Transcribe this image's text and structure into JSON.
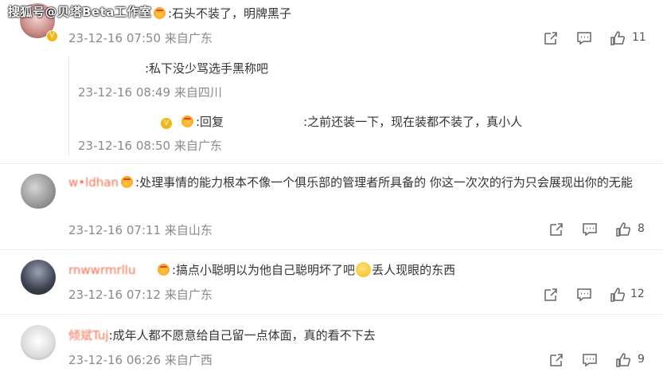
{
  "watermark": "搜狐号@贝塔Beta工作室",
  "comments": [
    {
      "user": "",
      "text": ":石头不装了，明牌黑子",
      "meta": "23-12-16 07:50 来自广东",
      "likes": "11",
      "replies": [
        {
          "user": "",
          "text": ":私下没少骂选手黑称吧",
          "meta": "23-12-16 08:49 来自四川"
        },
        {
          "user": "",
          "reply_prefix": ":回复",
          "reply_to": "",
          "text": ":之前还装一下，现在装都不装了，真小人",
          "meta": "23-12-16 08:50 来自广东"
        }
      ]
    },
    {
      "user": "w•ldhan",
      "text": ":处理事情的能力根本不像一个俱乐部的管理者所具备的 你这一次次的行为只会展现出你的无能",
      "meta": "23-12-16 07:11 来自山东",
      "likes": "8"
    },
    {
      "user": "rnwwrmrllu",
      "text_a": ":搞点小聪明以为他自己聪明坏了吧",
      "text_b": "丢人现眼的东西",
      "meta": "23-12-16 07:12 来自广东",
      "likes": "12"
    },
    {
      "user": "倾斌Tuj",
      "text": ":成年人都不愿意给自己留一点体面，真的看不下去",
      "meta": "23-12-16 06:26 来自广西",
      "likes": "9"
    }
  ],
  "icons": {
    "share": "share-icon",
    "comment": "comment-icon",
    "like": "thumb-up-icon"
  },
  "colors": {
    "username": "#eb7350",
    "meta": "#8a8a8a",
    "text": "#333333"
  }
}
